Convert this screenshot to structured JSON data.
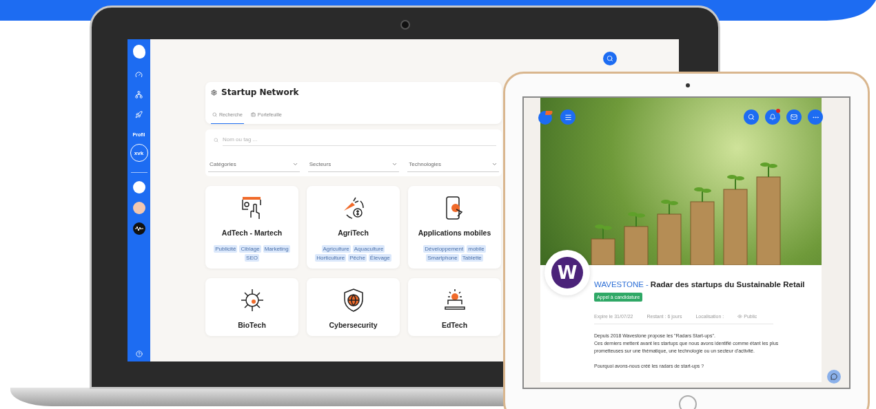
{
  "laptop": {
    "sidebar": {
      "profile_label": "Profil",
      "avatar": "xvk"
    },
    "page": {
      "title": "Startup Network",
      "tabs": [
        {
          "label": "Recherche",
          "selected": true
        },
        {
          "label": "Portefeuille",
          "selected": false
        }
      ],
      "search": {
        "placeholder": "Nom ou tag ..."
      },
      "filters": [
        {
          "label": "Catégories"
        },
        {
          "label": "Secteurs"
        },
        {
          "label": "Technologies"
        }
      ],
      "categories": [
        {
          "title": "AdTech - Martech",
          "tags": [
            "Publicité",
            "Ciblage",
            "Marketing",
            "SEO"
          ]
        },
        {
          "title": "AgriTech",
          "tags": [
            "Agriculture",
            "Aquaculture",
            "Horticulture",
            "Pêche",
            "Élevage"
          ]
        },
        {
          "title": "Applications mobiles",
          "tags": [
            "Développement",
            "mobile",
            "Smartphone",
            "Tablette"
          ]
        },
        {
          "title": "BioTech"
        },
        {
          "title": "Cybersecurity"
        },
        {
          "title": "EdTech"
        }
      ]
    }
  },
  "tablet": {
    "header": {
      "has_unread": true
    },
    "post": {
      "logo_letter": "W",
      "organization": "WAVESTONE",
      "separator": "-",
      "title": "Radar des startups du Sustainable Retail",
      "badge": "Appel à candidature",
      "meta": [
        "Expire le 31/07/22",
        "Restant : 6 jours",
        "Localisation :",
        "Public"
      ],
      "description": [
        "Depuis 2018 Wavestone propose les \"Radars Start-ups\".",
        "Ces derniers mettent avant les startups que nous avons identifié comme étant les plus prometteuses sur une thématique, une technologie ou un secteur d'activité."
      ],
      "question": "Pourquoi avons-nous créé les radars de start-ups ?"
    }
  }
}
